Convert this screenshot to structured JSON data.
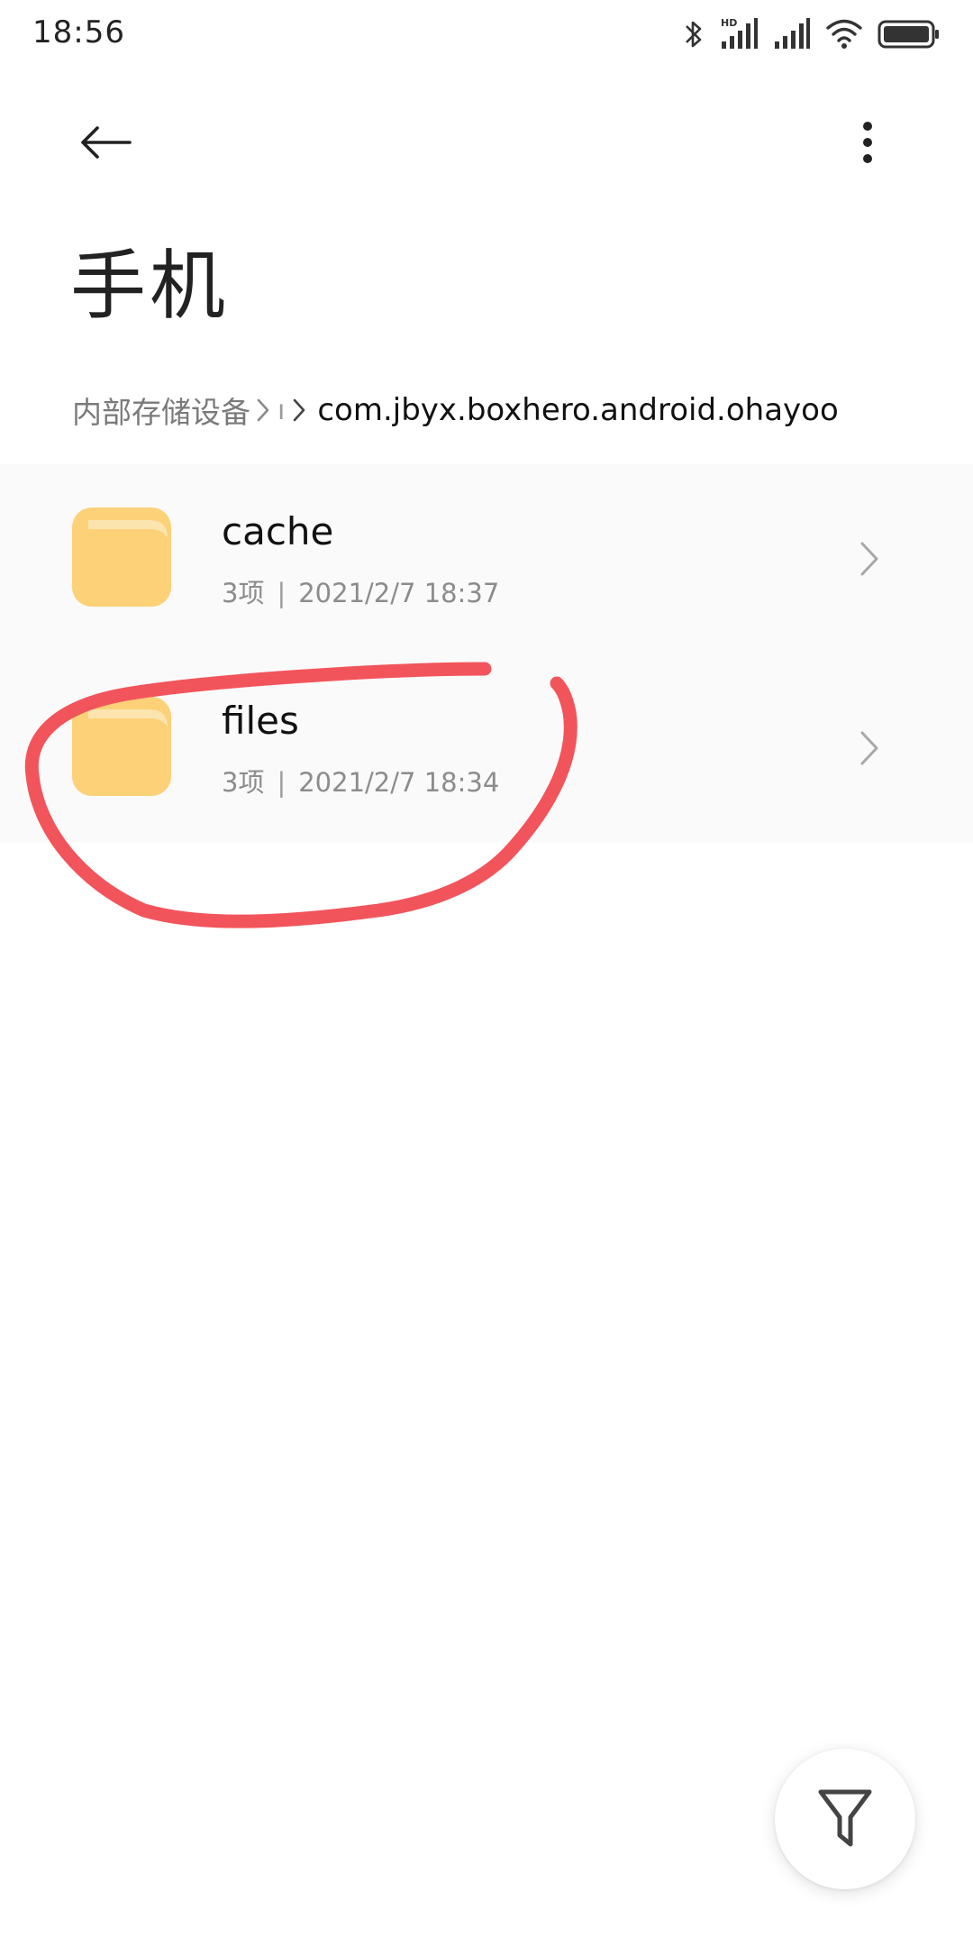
{
  "status_bar": {
    "time": "18:56",
    "icons": [
      "bluetooth-icon",
      "hd-signal-icon",
      "signal-icon",
      "wifi-icon",
      "battery-icon"
    ],
    "hd_label": "HD"
  },
  "app_bar": {
    "back_icon": "back-arrow-icon",
    "more_icon": "more-vert-icon"
  },
  "title": "手机",
  "breadcrumb": {
    "root": "内部存储设备",
    "collapsed": "ı",
    "current": "com.jbyx.boxhero.android.ohayoo"
  },
  "files": [
    {
      "name": "cache",
      "count": "3项",
      "date": "2021/2/7 18:37"
    },
    {
      "name": "files",
      "count": "3项",
      "date": "2021/2/7 18:34"
    }
  ],
  "meta_separator": "|",
  "colors": {
    "folder": "#FDD178",
    "folder_tab": "#FBE4AE",
    "annotation": "#F2545B",
    "list_bg": "#FAFAFA"
  },
  "fab": {
    "icon": "filter-icon"
  }
}
